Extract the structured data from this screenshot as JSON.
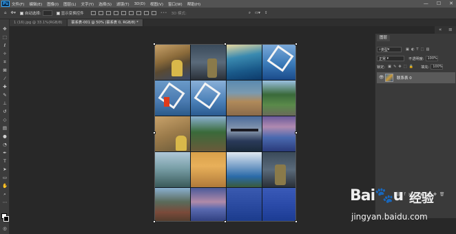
{
  "menubar": {
    "app_icon": "Ps",
    "items": [
      "文件(F)",
      "编辑(E)",
      "图像(I)",
      "图层(L)",
      "文字(Y)",
      "选择(S)",
      "滤镜(T)",
      "3D(D)",
      "视图(V)",
      "窗口(W)",
      "帮助(H)"
    ],
    "window_controls": [
      "—",
      "☐",
      "✕"
    ]
  },
  "options": {
    "auto_select_label": "自动选择:",
    "show_transform_label": "显示变换控件",
    "mode3d_label": "3D 模式:"
  },
  "tabs": [
    {
      "label": "1 (16).jpg @ 33.1%(RGB/8)"
    },
    {
      "label": "联系表-001 @ 50% (联系表 0, RGB/8) *"
    }
  ],
  "layers_panel": {
    "tab_label": "图层",
    "kind_label": "类型",
    "blend_mode": "正常",
    "opacity_label": "不透明度:",
    "opacity_value": "100%",
    "lock_label": "锁定:",
    "fill_label": "填充:",
    "fill_value": "100%",
    "layer_name": "联系表 0"
  },
  "watermark": {
    "url": "jingyan.baidu.com"
  },
  "colors": {
    "menubar_bg": "#535353",
    "panel_bg": "#3a3a3a",
    "canvas_bg": "#282828",
    "accent": "#31a8ff"
  }
}
